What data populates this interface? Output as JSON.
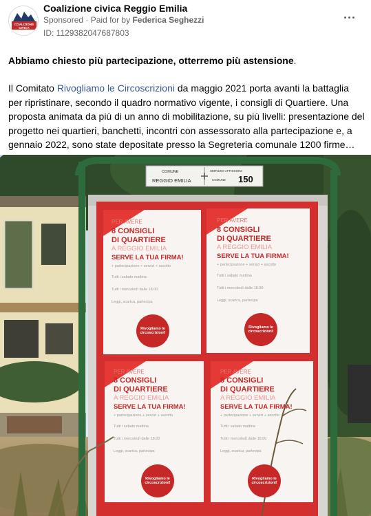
{
  "post": {
    "page_name": "Coalizione civica Reggio Emilia",
    "sponsored_label": "Sponsored",
    "separator": "·",
    "paid_for_prefix": "Paid for by",
    "payer": "Federica Seghezzi",
    "ad_id": "ID: 1129382047687803",
    "more_icon": "more-dots-icon",
    "avatar_text_line1": "COALIZIONE",
    "avatar_text_line2": "CIVICA",
    "headline": "Abbiamo chiesto più partecipazione, otterremo più astensione",
    "headline_end": ".",
    "body_part1": "Il Comitato ",
    "body_link": "Rivogliamo le Circoscrizioni",
    "body_part2": " da maggio 2021 porta avanti la battaglia per ripristinare, secondo il quadro normativo vigente, i consigli di Quartiere. Una proposta animata da più di un anno di mobilitazione, su più livelli: presentazione del progetto nei quartieri, banchetti, incontri con assessorato alla partecipazione e, a gennaio 2022, sono state depositate presso la Segreteria comunale 1200 firme…"
  },
  "photo": {
    "sign": {
      "left_line1": "COMUNE",
      "left_line2": "REGGIO EMILIA",
      "right_line1": "SERVIZIO AFFISSIONI",
      "right_line2": "COMUNE",
      "number": "150"
    },
    "posters": [
      {
        "line1": "PER AVERE",
        "line2": "8 CONSIGLI",
        "line3": "DI QUARTIERE",
        "line4": "A REGGIO EMILIA",
        "line5": "SERVE LA TUA FIRMA!",
        "badge": "Rivogliamo le circoscrizioni!"
      },
      {
        "line1": "PER AVERE",
        "line2": "8 CONSIGLI",
        "line3": "DI QUARTIERE",
        "line4": "A REGGIO EMILIA",
        "line5": "SERVE LA TUA FIRMA!",
        "badge": "Rivogliamo le circoscrizioni!"
      },
      {
        "line1": "PER AVERE",
        "line2": "8 CONSIGLI",
        "line3": "DI QUARTIERE",
        "line4": "A REGGIO EMILIA",
        "line5": "SERVE LA TUA FIRMA!",
        "badge": "Rivogliamo le circoscrizioni!"
      },
      {
        "line1": "PER AVERE",
        "line2": "8 CONSIGLI",
        "line3": "DI QUARTIERE",
        "line4": "A REGGIO EMILIA",
        "line5": "SERVE LA TUA FIRMA!",
        "badge": "Rivogliamo le circoscrizioni!"
      }
    ],
    "poster_details": {
      "sub": "+ partecipazione + servizi + ascolto",
      "l1": "Tutti i sabato mattina",
      "l2": "Tutti i mercoledì dalle 18.00",
      "l3": "Leggi, scarica, partecipa"
    }
  },
  "colors": {
    "brand_red": "#c62828",
    "link_blue": "#385898",
    "meta_gray": "#65676b"
  }
}
